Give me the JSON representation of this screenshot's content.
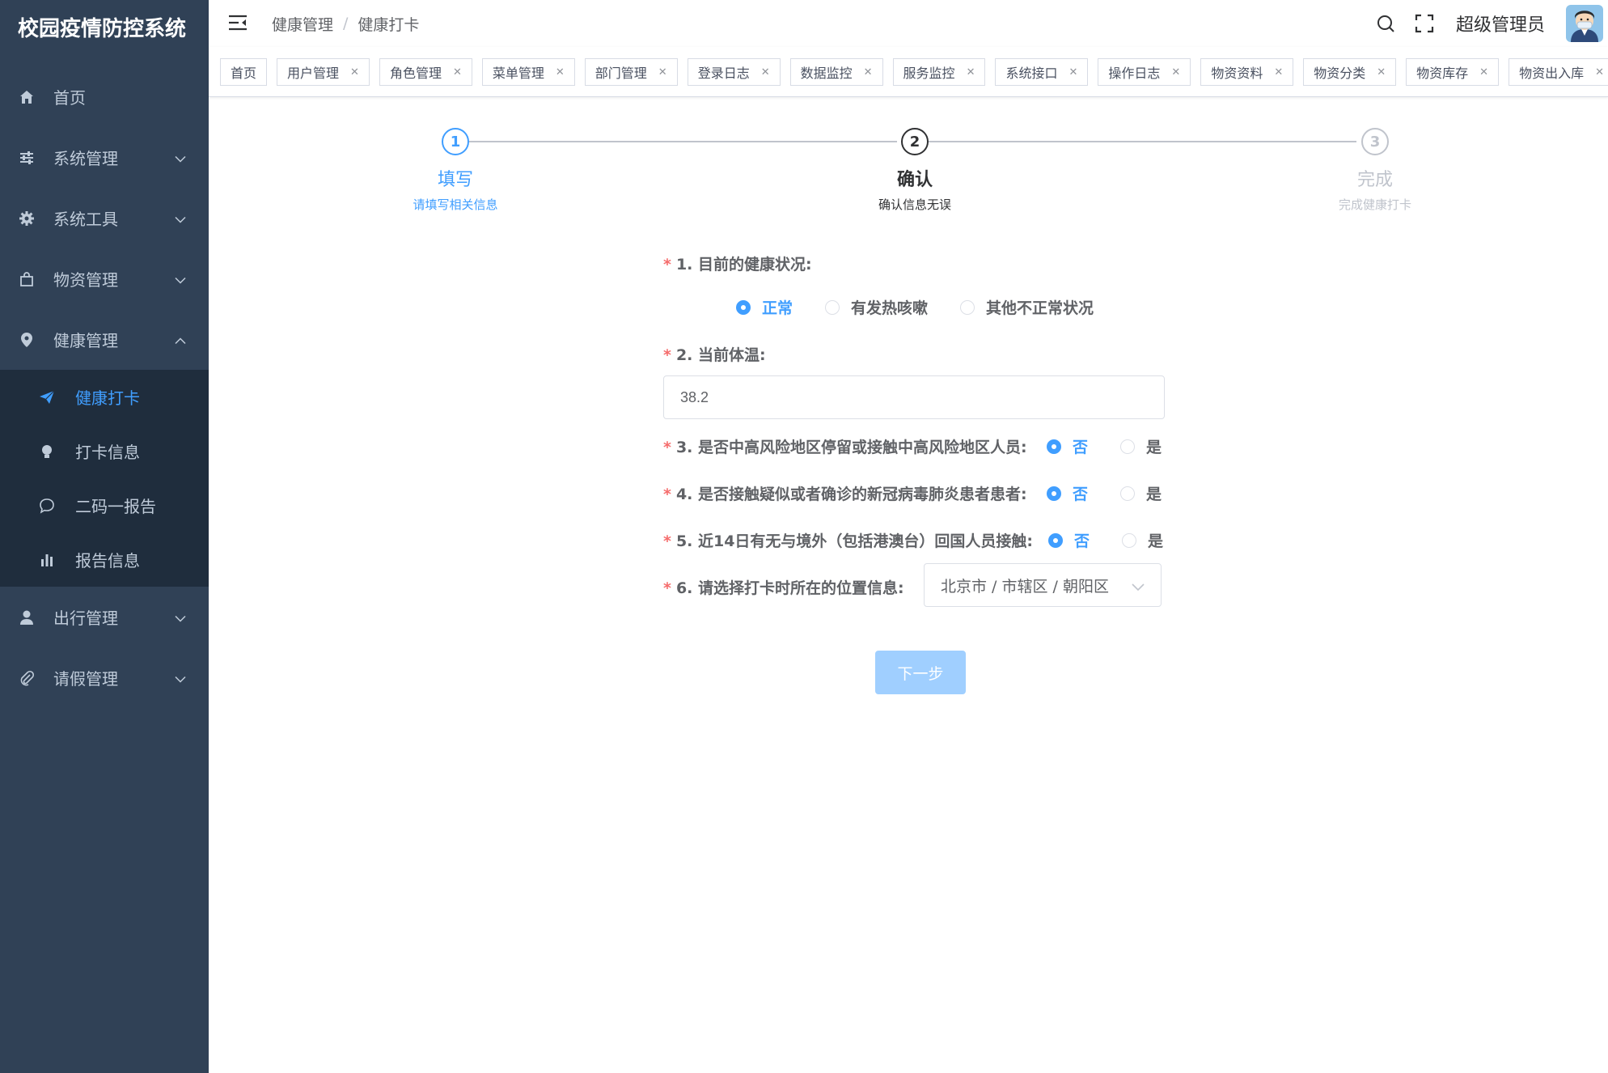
{
  "app": {
    "title": "校园疫情防控系统"
  },
  "sidebar": {
    "items": [
      {
        "label": "首页",
        "icon": "home-icon"
      },
      {
        "label": "系统管理",
        "icon": "sliders-icon"
      },
      {
        "label": "系统工具",
        "icon": "gear-icon"
      },
      {
        "label": "物资管理",
        "icon": "bag-icon"
      },
      {
        "label": "健康管理",
        "icon": "location-icon"
      }
    ],
    "health_sub": [
      {
        "label": "健康打卡",
        "icon": "paper-plane-icon",
        "active": true
      },
      {
        "label": "打卡信息",
        "icon": "bulb-icon"
      },
      {
        "label": "二码一报告",
        "icon": "chat-bubble-icon"
      },
      {
        "label": "报告信息",
        "icon": "bar-chart-icon"
      }
    ],
    "items_after": [
      {
        "label": "出行管理",
        "icon": "user-icon"
      },
      {
        "label": "请假管理",
        "icon": "paperclip-icon"
      }
    ]
  },
  "navbar": {
    "breadcrumb": [
      "健康管理",
      "健康打卡"
    ],
    "breadcrumb_sep": "/",
    "username": "超级管理员"
  },
  "tags": [
    "首页",
    "用户管理",
    "角色管理",
    "菜单管理",
    "部门管理",
    "登录日志",
    "数据监控",
    "服务监控",
    "系统接口",
    "操作日志",
    "物资资料",
    "物资分类",
    "物资库存",
    "物资出入库"
  ],
  "steps": [
    {
      "num": "1",
      "title": "填写",
      "desc": "请填写相关信息"
    },
    {
      "num": "2",
      "title": "确认",
      "desc": "确认信息无误"
    },
    {
      "num": "3",
      "title": "完成",
      "desc": "完成健康打卡"
    }
  ],
  "form": {
    "required_mark": "*",
    "q1": {
      "label": "1. 目前的健康状况:",
      "options": [
        "正常",
        "有发热咳嗽",
        "其他不正常状况"
      ],
      "selected": "正常"
    },
    "q2": {
      "label": "2. 当前体温:",
      "value": "38.2"
    },
    "q3": {
      "label": "3. 是否中高风险地区停留或接触中高风险地区人员:",
      "options": [
        "否",
        "是"
      ],
      "selected": "否"
    },
    "q4": {
      "label": "4. 是否接触疑似或者确诊的新冠病毒肺炎患者患者:",
      "options": [
        "否",
        "是"
      ],
      "selected": "否"
    },
    "q5": {
      "label": "5. 近14日有无与境外（包括港澳台）回国人员接触:",
      "options": [
        "否",
        "是"
      ],
      "selected": "否"
    },
    "q6": {
      "label": "6. 请选择打卡时所在的位置信息:",
      "value": "北京市 / 市辖区 / 朝阳区"
    },
    "next_button": "下一步"
  },
  "colors": {
    "sidebar_bg": "#304156",
    "submenu_bg": "#1f2d3d",
    "primary": "#409eff",
    "required": "#f56c6c",
    "disabled_button": "#a0cfff"
  }
}
